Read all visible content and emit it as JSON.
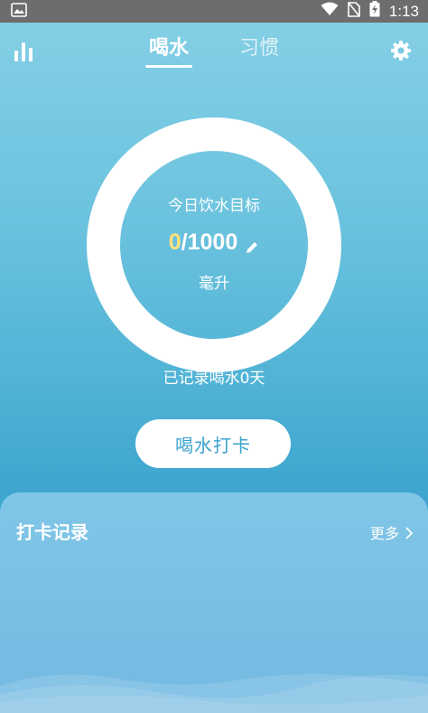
{
  "status_bar": {
    "time": "1:13",
    "battery_label": "⚡"
  },
  "header": {
    "tabs": [
      {
        "label": "喝水",
        "active": true
      },
      {
        "label": "习惯",
        "active": false
      }
    ]
  },
  "goal": {
    "title": "今日饮水目标",
    "current": "0",
    "separator": "/",
    "target": "1000",
    "unit": "毫升",
    "progress": 0
  },
  "record_days": "已记录喝水0天",
  "checkin_button_label": "喝水打卡",
  "records": {
    "title": "打卡记录",
    "more_label": "更多"
  },
  "colors": {
    "accent": "#3aa2cc",
    "highlight": "#ffe27a"
  }
}
